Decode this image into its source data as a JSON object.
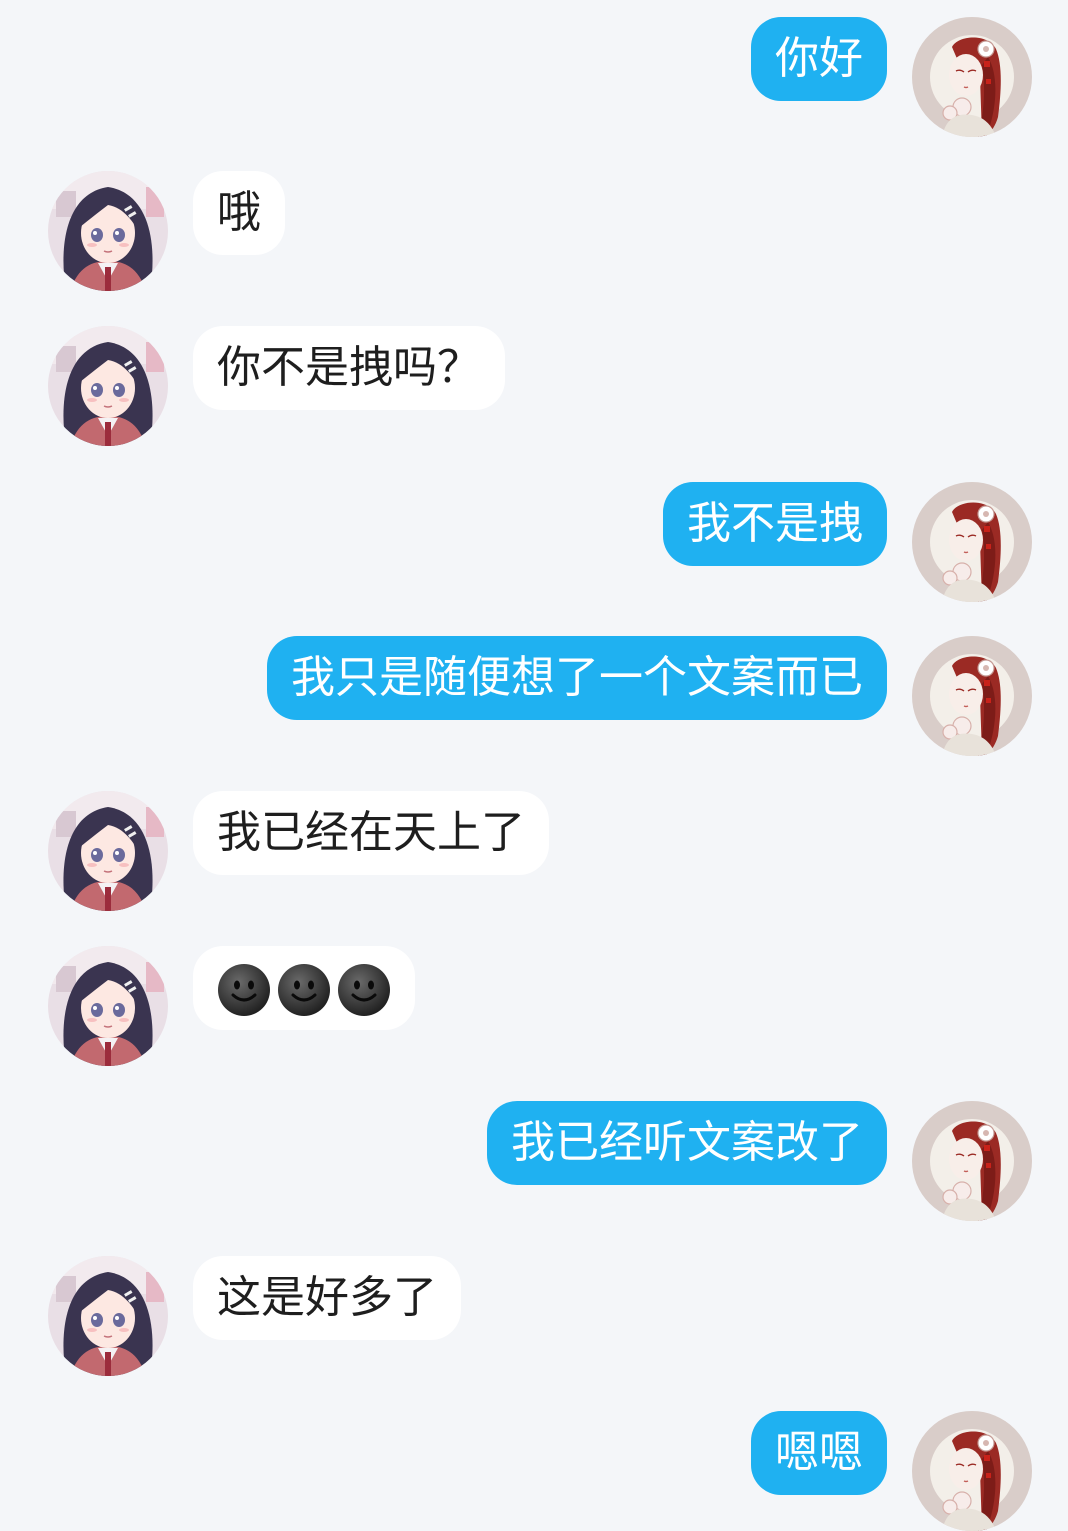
{
  "messages": [
    {
      "side": "out",
      "text": "你好"
    },
    {
      "side": "in",
      "text": "哦"
    },
    {
      "side": "in",
      "text": "你不是拽吗？"
    },
    {
      "side": "out",
      "text": "我不是拽"
    },
    {
      "side": "out",
      "text": "我只是随便想了一个文案而已"
    },
    {
      "side": "in",
      "text": "我已经在天上了"
    },
    {
      "side": "in",
      "emoji": [
        "smiling-dark-face-icon",
        "smiling-dark-face-icon",
        "smiling-dark-face-icon"
      ]
    },
    {
      "side": "out",
      "text": "我已经听文案改了"
    },
    {
      "side": "in",
      "text": "这是好多了"
    },
    {
      "side": "out",
      "text": "嗯嗯"
    }
  ],
  "avatars": {
    "contact": "anime-girl-dark-hair-avatar",
    "self": "illustrated-girl-red-hair-avatar"
  },
  "colors": {
    "background": "#f4f6f9",
    "outgoing_bubble": "#1fb1f1",
    "incoming_bubble": "#ffffff"
  }
}
